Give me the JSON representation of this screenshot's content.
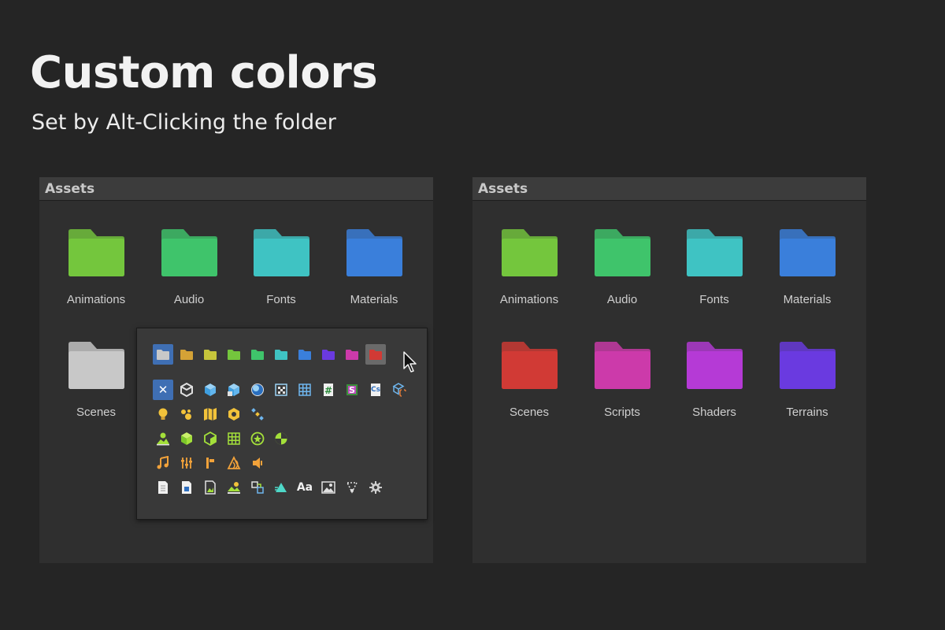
{
  "hero": {
    "title": "Custom colors",
    "subtitle": "Set by Alt-Clicking the folder"
  },
  "left_panel": {
    "header": "Assets",
    "folders": [
      {
        "label": "Animations",
        "color": "#74c63d"
      },
      {
        "label": "Audio",
        "color": "#3fc46b"
      },
      {
        "label": "Fonts",
        "color": "#3fc3c3"
      },
      {
        "label": "Materials",
        "color": "#3a7fdb"
      },
      {
        "label": "Scenes",
        "color": "#c8c8c8"
      }
    ]
  },
  "right_panel": {
    "header": "Assets",
    "folders": [
      {
        "label": "Animations",
        "color": "#74c63d"
      },
      {
        "label": "Audio",
        "color": "#3fc46b"
      },
      {
        "label": "Fonts",
        "color": "#3fc3c3"
      },
      {
        "label": "Materials",
        "color": "#3a7fdb"
      },
      {
        "label": "Scenes",
        "color": "#d13a35"
      },
      {
        "label": "Scripts",
        "color": "#cc3aaa"
      },
      {
        "label": "Shaders",
        "color": "#b53ad6"
      },
      {
        "label": "Terrains",
        "color": "#6a3ae0"
      }
    ]
  },
  "popup": {
    "swatch_colors": [
      "#c8c8c8",
      "#d4a236",
      "#c6c53b",
      "#74c63d",
      "#3fc46b",
      "#3fc3c3",
      "#3a7fdb",
      "#6a3ae0",
      "#cc3aaa",
      "#d13a35"
    ],
    "text_icons": {
      "csharp": "Cs",
      "shader": "S",
      "hash": "#",
      "font": "Aa",
      "clear": "✕"
    }
  }
}
